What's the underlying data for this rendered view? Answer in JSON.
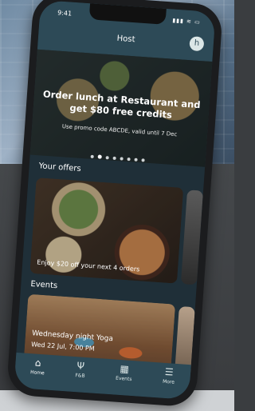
{
  "status": {
    "time": "9:41",
    "icons": "▮▮▮ ≋ ▭"
  },
  "header": {
    "title": "Host",
    "avatar_letter": "h"
  },
  "banner": {
    "title": "Order lunch at Restaurant and get $80 free credits",
    "subtitle": "Use promo code ABCDE, valid until 7 Dec",
    "dots": 8,
    "active_dot": 1
  },
  "offers": {
    "title": "Your offers",
    "card_text": "Enjoy $20 off your next 4 orders"
  },
  "events": {
    "title": "Events",
    "event_name": "Wednesday night Yoga",
    "event_date": "Wed 22 Jul, 7:00 PM"
  },
  "tabs": [
    {
      "label": "Home",
      "icon": "home-icon",
      "glyph": "⌂"
    },
    {
      "label": "F&B",
      "icon": "fork-knife-icon",
      "glyph": "Ψ"
    },
    {
      "label": "Events",
      "icon": "calendar-icon",
      "glyph": "▦"
    },
    {
      "label": "More",
      "icon": "menu-icon",
      "glyph": "☰"
    }
  ]
}
